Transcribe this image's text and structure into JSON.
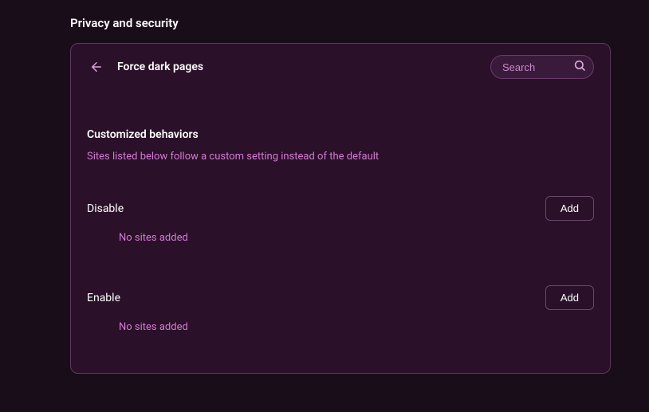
{
  "header": {
    "title": "Privacy and security"
  },
  "card": {
    "title": "Force dark pages",
    "search_placeholder": "Search"
  },
  "section": {
    "title": "Customized behaviors",
    "description": "Sites listed below follow a custom setting instead of the default"
  },
  "groups": [
    {
      "label": "Disable",
      "add_label": "Add",
      "empty": "No sites added"
    },
    {
      "label": "Enable",
      "add_label": "Add",
      "empty": "No sites added"
    }
  ]
}
